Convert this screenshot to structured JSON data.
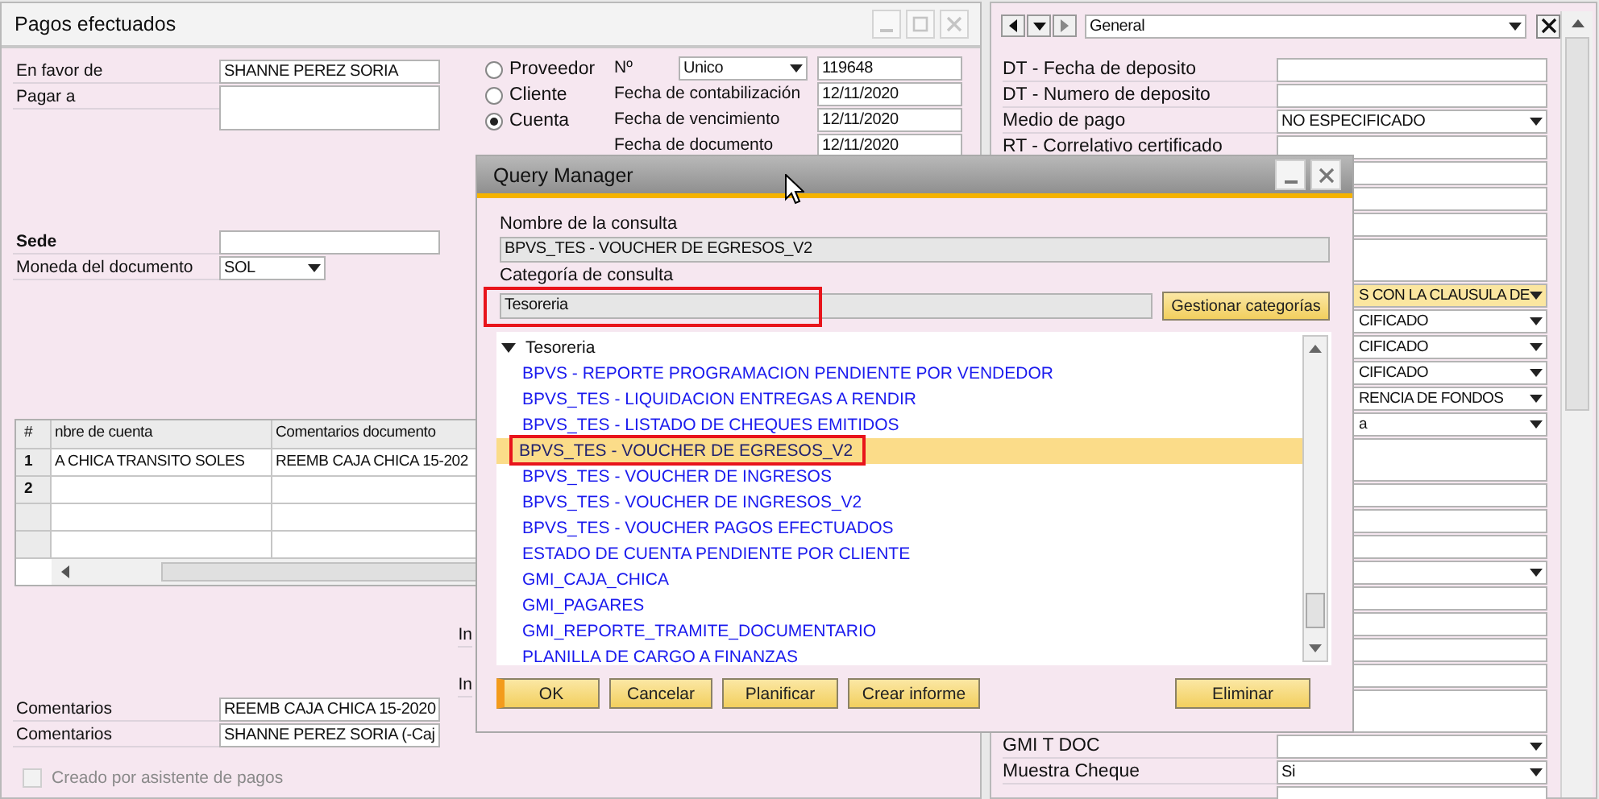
{
  "payment_window": {
    "title": "Pagos efectuados",
    "party_fields": [
      {
        "label": "En favor de",
        "kind": "text",
        "value": "SHANNE PEREZ SORIA"
      },
      {
        "label": "Pagar a",
        "kind": "textarea"
      }
    ],
    "currency_fields": [
      {
        "label": "Sede",
        "bold": true,
        "kind": "text"
      },
      {
        "label": "Moneda del documento",
        "bold": false,
        "kind": "dropdown",
        "value": "SOL"
      }
    ],
    "partner_types": [
      {
        "label": "Proveedor",
        "selected": false
      },
      {
        "label": "Cliente",
        "selected": false
      },
      {
        "label": "Cuenta",
        "selected": true
      }
    ],
    "number": {
      "label": "Nº",
      "series": "Unico",
      "value": "119648"
    },
    "dates": [
      {
        "label": "Fecha de contabilización",
        "value": "12/11/2020"
      },
      {
        "label": "Fecha de vencimiento",
        "value": "12/11/2020"
      },
      {
        "label": "Fecha de documento",
        "value": "12/11/2020"
      }
    ],
    "grid": {
      "columns": [
        "#",
        "nbre de cuenta",
        "Comentarios documento"
      ],
      "rows": [
        {
          "number": "1",
          "account": "A CHICA TRANSITO SOLES",
          "comment": "REEMB CAJA CHICA 15-202"
        },
        {
          "number": "2"
        }
      ]
    },
    "cut_labels": [
      "In",
      "In"
    ],
    "comments": [
      {
        "label": "Comentarios",
        "value": "REEMB CAJA CHICA 15-2020"
      },
      {
        "label": "Comentarios",
        "value": "SHANNE PEREZ SORIA (-Caj"
      }
    ],
    "wizard_checkbox": {
      "label": "Creado por asistente de pagos",
      "checked": false,
      "disabled": true
    }
  },
  "user_fields_panel": {
    "category": "General",
    "rows": [
      {
        "label": "DT - Fecha de deposito",
        "kind": "field"
      },
      {
        "label": "DT - Numero de deposito",
        "kind": "field"
      },
      {
        "label": "Medio de pago",
        "kind": "dropdown",
        "value": "NO ESPECIFICADO"
      },
      {
        "label": "RT - Correlativo certificado",
        "kind": "field"
      },
      {
        "kind": "field"
      },
      {
        "kind": "field"
      },
      {
        "kind": "field"
      },
      {
        "kind": "textarea"
      },
      {
        "kind": "dropdown",
        "value": "S CON LA CLAUSULA DE",
        "highlighted": true
      },
      {
        "kind": "dropdown",
        "value": "CIFICADO",
        "highlighted": false
      },
      {
        "kind": "dropdown",
        "value": "CIFICADO",
        "highlighted": false
      },
      {
        "kind": "dropdown",
        "value": "CIFICADO",
        "highlighted": false
      },
      {
        "kind": "dropdown",
        "value": "RENCIA DE FONDOS",
        "highlighted": false
      },
      {
        "kind": "dropdown",
        "value": "a",
        "highlighted": false
      },
      {
        "kind": "textarea"
      },
      {
        "kind": "field"
      },
      {
        "kind": "field"
      },
      {
        "kind": "field"
      },
      {
        "kind": "dropdown"
      },
      {
        "kind": "field"
      },
      {
        "kind": "field"
      },
      {
        "kind": "field"
      },
      {
        "kind": "field"
      },
      {
        "kind": "textarea"
      },
      {
        "label": "GMI  T  DOC",
        "kind": "dropdown"
      },
      {
        "label": "Muestra Cheque",
        "kind": "dropdown",
        "value": "Si"
      },
      {
        "kind": "field"
      }
    ]
  },
  "query_manager": {
    "title": "Query Manager",
    "name_label": "Nombre de la consulta",
    "name_value": "BPVS_TES - VOUCHER DE EGRESOS_V2",
    "category_label": "Categoría de consulta",
    "category_value": "Tesoreria",
    "category_highlighted": true,
    "manage_button": "Gestionar categorías",
    "tree": {
      "label": "Tesoreria",
      "expanded": true,
      "children": [
        {
          "label": "BPVS - REPORTE PROGRAMACION PENDIENTE POR VENDEDOR",
          "selected": false,
          "highlighted": false
        },
        {
          "label": "BPVS_TES - LIQUIDACION ENTREGAS A RENDIR",
          "selected": false,
          "highlighted": false
        },
        {
          "label": "BPVS_TES - LISTADO DE CHEQUES EMITIDOS",
          "selected": false,
          "highlighted": false
        },
        {
          "label": "BPVS_TES - VOUCHER DE EGRESOS_V2",
          "selected": true,
          "highlighted": true
        },
        {
          "label": "BPVS_TES - VOUCHER DE INGRESOS",
          "selected": false,
          "highlighted": false
        },
        {
          "label": "BPVS_TES - VOUCHER DE INGRESOS_V2",
          "selected": false,
          "highlighted": false
        },
        {
          "label": "BPVS_TES - VOUCHER PAGOS EFECTUADOS",
          "selected": false,
          "highlighted": false
        },
        {
          "label": "ESTADO DE CUENTA PENDIENTE POR CLIENTE",
          "selected": false,
          "highlighted": false
        },
        {
          "label": "GMI_CAJA_CHICA",
          "selected": false,
          "highlighted": false
        },
        {
          "label": "GMI_PAGARES",
          "selected": false,
          "highlighted": false
        },
        {
          "label": "GMI_REPORTE_TRAMITE_DOCUMENTARIO",
          "selected": false,
          "highlighted": false
        },
        {
          "label": "PLANILLA DE CARGO A FINANZAS",
          "selected": false,
          "highlighted": false
        }
      ]
    },
    "buttons": [
      {
        "label": "OK",
        "default": true
      },
      {
        "label": "Cancelar",
        "default": false
      },
      {
        "label": "Planificar",
        "default": false
      },
      {
        "label": "Crear informe",
        "default": false
      },
      {
        "label": "Eliminar",
        "default": false
      }
    ]
  }
}
